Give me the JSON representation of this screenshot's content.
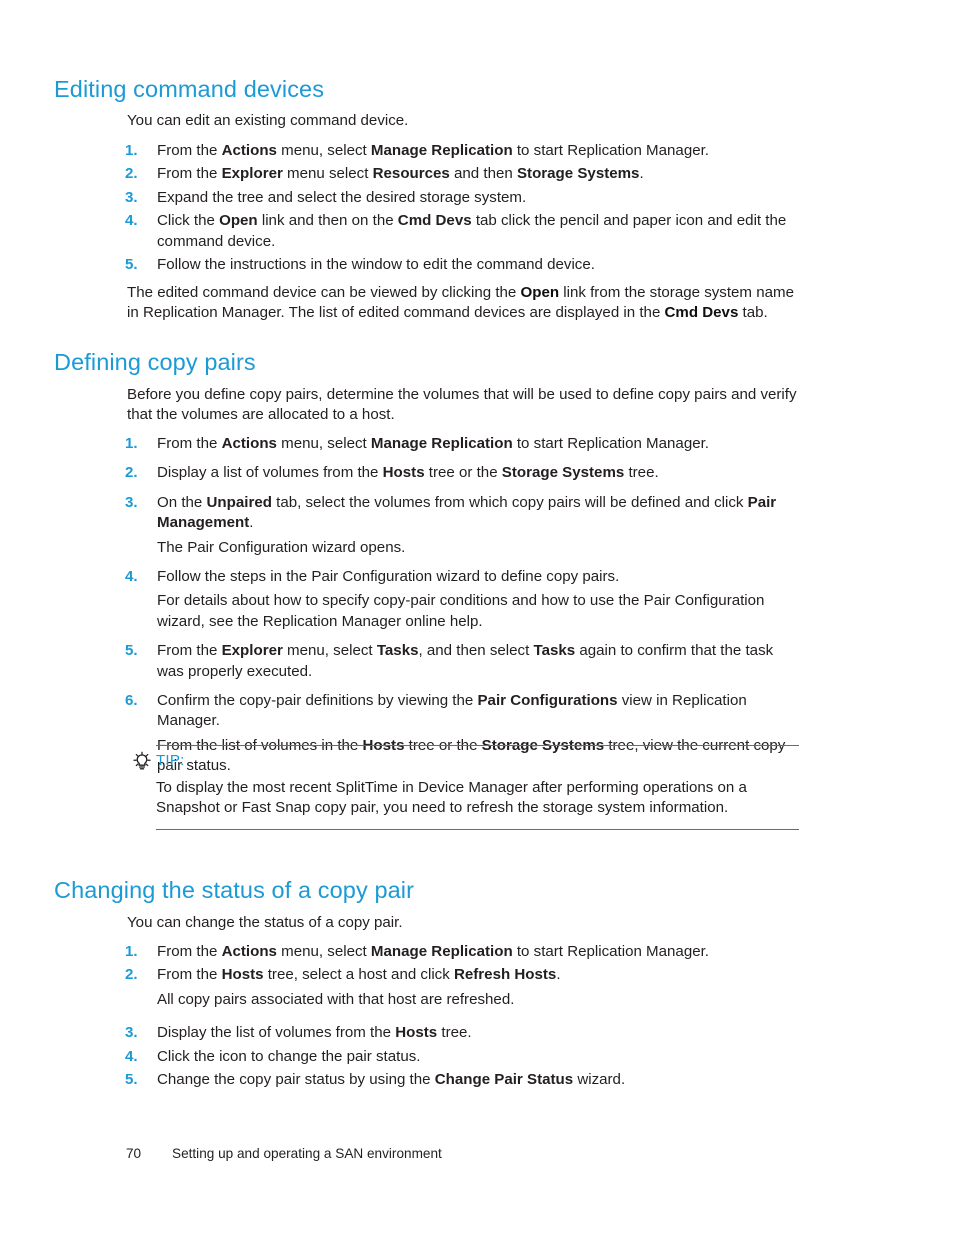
{
  "page": {
    "number": "70",
    "footer_text": "Setting up and operating a SAN environment",
    "heading_color": "#1b9ad6",
    "text_color": "#231f20",
    "rule_color": "#1b82c4"
  },
  "sections": [
    {
      "id": "editing-command-devices",
      "heading": "Editing command devices",
      "intro": "You can edit an existing command device.",
      "steps": [
        {
          "num": "1.",
          "runs": [
            {
              "t": "From the ",
              "b": false
            },
            {
              "t": "Actions",
              "b": true
            },
            {
              "t": " menu, select ",
              "b": false
            },
            {
              "t": "Manage Replication",
              "b": true
            },
            {
              "t": " to start Replication Manager.",
              "b": false
            }
          ]
        },
        {
          "num": "2.",
          "runs": [
            {
              "t": "From the ",
              "b": false
            },
            {
              "t": "Explorer",
              "b": true
            },
            {
              "t": " menu select ",
              "b": false
            },
            {
              "t": "Resources",
              "b": true
            },
            {
              "t": " and then ",
              "b": false
            },
            {
              "t": "Storage Systems",
              "b": true
            },
            {
              "t": ".",
              "b": false
            }
          ]
        },
        {
          "num": "3.",
          "runs": [
            {
              "t": "Expand the tree and select the desired storage system.",
              "b": false
            }
          ]
        },
        {
          "num": "4.",
          "runs": [
            {
              "t": "Click the ",
              "b": false
            },
            {
              "t": "Open",
              "b": true
            },
            {
              "t": " link and then on the ",
              "b": false
            },
            {
              "t": "Cmd Devs",
              "b": true
            },
            {
              "t": " tab click the pencil and paper icon and edit the command device.",
              "b": false
            }
          ]
        },
        {
          "num": "5.",
          "runs": [
            {
              "t": "Follow the instructions in the window to edit the command device.",
              "b": false
            }
          ]
        }
      ],
      "outro_runs": [
        {
          "t": "The edited command device can be viewed by clicking the ",
          "b": false
        },
        {
          "t": "Open",
          "b": true
        },
        {
          "t": " link from the storage system name in Replication Manager. The list of edited command devices are displayed in the ",
          "b": false
        },
        {
          "t": "Cmd Devs",
          "b": true
        },
        {
          "t": " tab.",
          "b": false
        }
      ]
    },
    {
      "id": "defining-copy-pairs",
      "heading": "Defining copy pairs",
      "intro": "Before you define copy pairs, determine the volumes that will be used to define copy pairs and verify that the volumes are allocated to a host.",
      "steps": [
        {
          "num": "1.",
          "runs": [
            {
              "t": "From the ",
              "b": false
            },
            {
              "t": "Actions",
              "b": true
            },
            {
              "t": " menu, select ",
              "b": false
            },
            {
              "t": "Manage Replication",
              "b": true
            },
            {
              "t": " to start Replication Manager.",
              "b": false
            }
          ]
        },
        {
          "num": "2.",
          "runs": [
            {
              "t": "Display a list of volumes from the ",
              "b": false
            },
            {
              "t": "Hosts",
              "b": true
            },
            {
              "t": " tree or the ",
              "b": false
            },
            {
              "t": "Storage Systems",
              "b": true
            },
            {
              "t": " tree.",
              "b": false
            }
          ]
        },
        {
          "num": "3.",
          "runs": [
            {
              "t": "On the ",
              "b": false
            },
            {
              "t": "Unpaired",
              "b": true
            },
            {
              "t": " tab, select the volumes from which copy pairs will be defined and click ",
              "b": false
            },
            {
              "t": "Pair Management",
              "b": true
            },
            {
              "t": ".",
              "b": false
            }
          ],
          "sub_runs": [
            {
              "t": "The Pair Configuration wizard opens.",
              "b": false
            }
          ]
        },
        {
          "num": "4.",
          "runs": [
            {
              "t": "Follow the steps in the Pair Configuration wizard to define copy pairs.",
              "b": false
            }
          ],
          "sub_runs": [
            {
              "t": "For details about how to specify copy-pair conditions and how to use the Pair Configuration wizard, see the Replication Manager online help.",
              "b": false
            }
          ]
        },
        {
          "num": "5.",
          "runs": [
            {
              "t": "From the ",
              "b": false
            },
            {
              "t": "Explorer",
              "b": true
            },
            {
              "t": " menu, select ",
              "b": false
            },
            {
              "t": "Tasks",
              "b": true
            },
            {
              "t": ", and then select ",
              "b": false
            },
            {
              "t": "Tasks",
              "b": true
            },
            {
              "t": " again to confirm that the task was properly executed.",
              "b": false
            }
          ]
        },
        {
          "num": "6.",
          "runs": [
            {
              "t": "Confirm the copy-pair definitions by viewing the ",
              "b": false
            },
            {
              "t": "Pair Configurations",
              "b": true
            },
            {
              "t": " view in Replication Manager.",
              "b": false
            }
          ],
          "sub_runs": [
            {
              "t": "From the list of volumes in the ",
              "b": false
            },
            {
              "t": "Hosts",
              "b": true
            },
            {
              "t": " tree or the ",
              "b": false
            },
            {
              "t": "Storage Systems",
              "b": true
            },
            {
              "t": " tree, view the current copy pair status.",
              "b": false
            }
          ]
        }
      ]
    },
    {
      "id": "changing-the-status-of-a-copy-pair",
      "heading": "Changing the status of a copy pair",
      "intro": "You can change the status of a copy pair.",
      "steps": [
        {
          "num": "1.",
          "runs": [
            {
              "t": "From the ",
              "b": false
            },
            {
              "t": "Actions",
              "b": true
            },
            {
              "t": " menu, select ",
              "b": false
            },
            {
              "t": "Manage Replication",
              "b": true
            },
            {
              "t": " to start Replication Manager.",
              "b": false
            }
          ]
        },
        {
          "num": "2.",
          "runs": [
            {
              "t": "From the ",
              "b": false
            },
            {
              "t": "Hosts",
              "b": true
            },
            {
              "t": " tree, select a host and click ",
              "b": false
            },
            {
              "t": "Refresh Hosts",
              "b": true
            },
            {
              "t": ".",
              "b": false
            }
          ],
          "sub_runs": [
            {
              "t": "All copy pairs associated with that host are refreshed.",
              "b": false
            }
          ]
        },
        {
          "num": "3.",
          "runs": [
            {
              "t": "Display the list of volumes from the ",
              "b": false
            },
            {
              "t": "Hosts",
              "b": true
            },
            {
              "t": " tree.",
              "b": false
            }
          ]
        },
        {
          "num": "4.",
          "runs": [
            {
              "t": "Click the icon to change the pair status.",
              "b": false
            }
          ]
        },
        {
          "num": "5.",
          "runs": [
            {
              "t": "Change the copy pair status by using the ",
              "b": false
            },
            {
              "t": "Change Pair Status",
              "b": true
            },
            {
              "t": " wizard.",
              "b": false
            }
          ]
        }
      ]
    }
  ],
  "tip": {
    "icon": "lightbulb-icon",
    "label": "TIP:",
    "body": "To display the most recent SplitTime in Device Manager after performing operations on a Snapshot or Fast Snap copy pair, you need to refresh the storage system information."
  }
}
